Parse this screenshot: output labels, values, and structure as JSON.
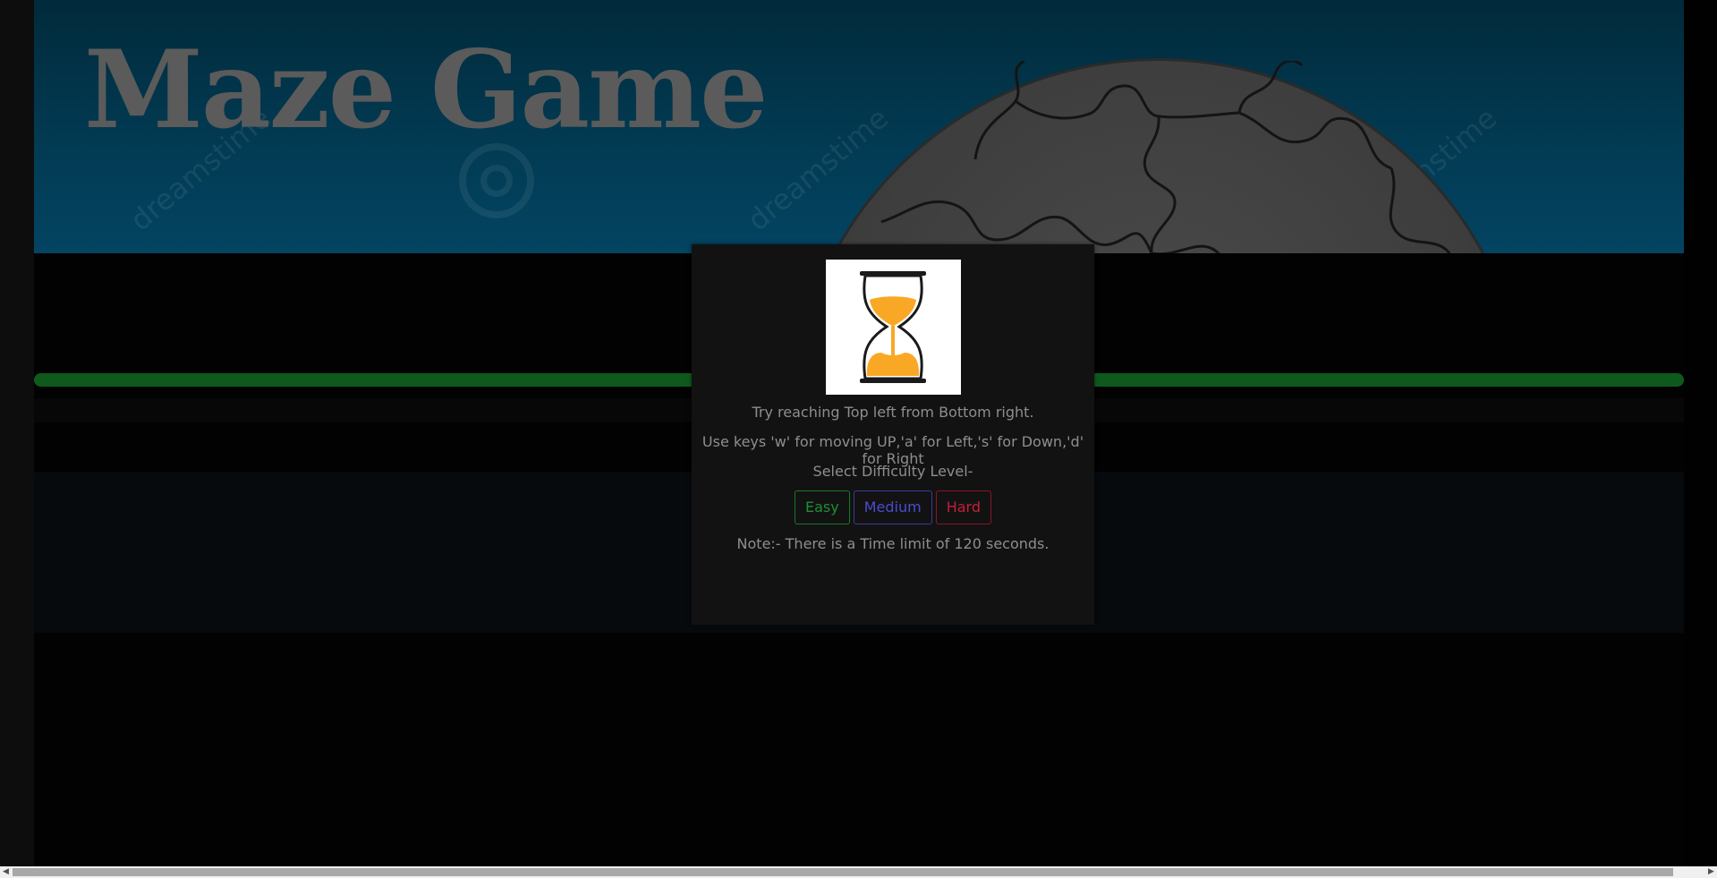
{
  "banner": {
    "title": "Maze Game"
  },
  "modal": {
    "instruction": "Try reaching Top left from Bottom right.",
    "keys_help": "Use keys 'w' for moving UP,'a' for Left,'s' for Down,'d' for Right",
    "difficulty_prompt": "Select Difficulty Level-",
    "difficulty_options": {
      "easy": "Easy",
      "medium": "Medium",
      "hard": "Hard"
    },
    "note": "Note:- There is a Time limit of 120 seconds.",
    "image_icon": "hourglass-icon"
  },
  "progress": {
    "fraction": 1.0
  },
  "colors": {
    "banner_bg": "#023a52",
    "progress_bar": "#0e5a1c",
    "modal_bg": "#121212",
    "easy": "#1e8f36",
    "medium": "#4b4bd0",
    "hard": "#c51f3a",
    "hourglass_sand": "#f9a825"
  }
}
